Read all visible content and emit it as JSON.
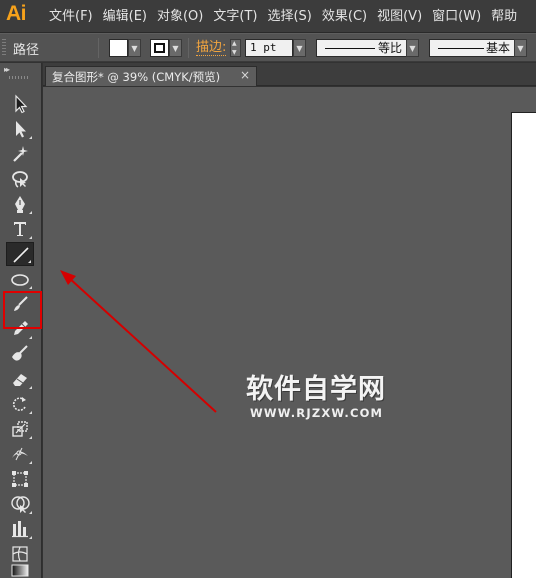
{
  "app": {
    "logo": "Ai",
    "brand_color": "#f7a21b"
  },
  "menubar": {
    "items": [
      {
        "label": "文件(F)"
      },
      {
        "label": "编辑(E)"
      },
      {
        "label": "对象(O)"
      },
      {
        "label": "文字(T)"
      },
      {
        "label": "选择(S)"
      },
      {
        "label": "效果(C)"
      },
      {
        "label": "视图(V)"
      },
      {
        "label": "窗口(W)"
      },
      {
        "label": "帮助"
      }
    ]
  },
  "controlbar": {
    "tool_name": "路径",
    "fill_color": "#ffffff",
    "stroke_label": "描边:",
    "stroke_weight": "1 pt",
    "variable_width_profile": "等比",
    "brush_definition": "基本"
  },
  "toolbar": {
    "tools": [
      {
        "icon": "selection-tool-icon"
      },
      {
        "icon": "direct-selection-tool-icon"
      },
      {
        "icon": "magic-wand-tool-icon"
      },
      {
        "icon": "lasso-tool-icon"
      },
      {
        "icon": "pen-tool-icon"
      },
      {
        "icon": "type-tool-icon"
      },
      {
        "icon": "line-segment-tool-icon",
        "active": true
      },
      {
        "icon": "ellipse-tool-icon"
      },
      {
        "icon": "paintbrush-tool-icon"
      },
      {
        "icon": "pencil-tool-icon"
      },
      {
        "icon": "blob-brush-tool-icon"
      },
      {
        "icon": "eraser-tool-icon"
      },
      {
        "icon": "rotate-tool-icon"
      },
      {
        "icon": "scale-tool-icon"
      },
      {
        "icon": "width-tool-icon"
      },
      {
        "icon": "free-transform-tool-icon"
      },
      {
        "icon": "shape-builder-tool-icon"
      },
      {
        "icon": "graph-tool-icon"
      },
      {
        "icon": "mesh-tool-icon"
      },
      {
        "icon": "gradient-tool-icon"
      }
    ],
    "highlight_color": "#e00000"
  },
  "document": {
    "tab_title": "复合图形* @ 39% (CMYK/预览)",
    "close_glyph": "×"
  },
  "watermark": {
    "title": "软件自学网",
    "url": "WWW.RJZXW.COM"
  },
  "annotation": {
    "arrow_color": "#d40000"
  }
}
